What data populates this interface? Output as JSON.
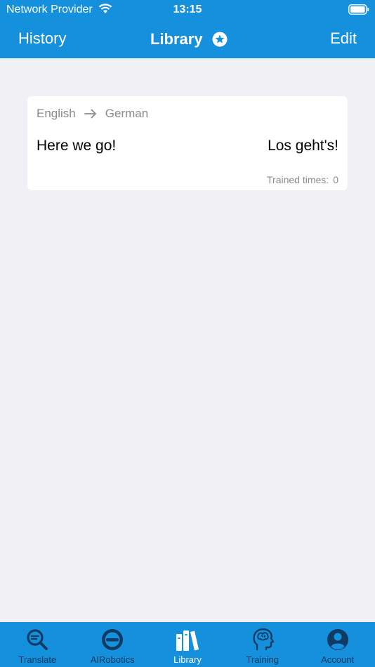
{
  "status_bar": {
    "carrier": "Network Provider",
    "time": "13:15",
    "wifi_icon": "wifi-icon",
    "battery_icon": "battery-icon"
  },
  "nav": {
    "left_label": "History",
    "title": "Library",
    "title_icon": "star-badge-icon",
    "right_label": "Edit"
  },
  "card": {
    "source_language": "English",
    "target_language": "German",
    "source_text": "Here we go!",
    "target_text": "Los geht's!",
    "trained_label": "Trained times:",
    "trained_count": "0"
  },
  "tabs": [
    {
      "label": "Translate",
      "icon": "magnifier-translate-icon",
      "active": false
    },
    {
      "label": "AIRobotics",
      "icon": "robot-face-icon",
      "active": false
    },
    {
      "label": "Library",
      "icon": "books-icon",
      "active": true
    },
    {
      "label": "Training",
      "icon": "brain-head-icon",
      "active": false
    },
    {
      "label": "Account",
      "icon": "user-avatar-icon",
      "active": false
    }
  ],
  "colors": {
    "brand": "#1590dc",
    "tab_inactive": "#0e3a64",
    "tab_active": "#ffffff",
    "background": "#f1f0f5"
  }
}
